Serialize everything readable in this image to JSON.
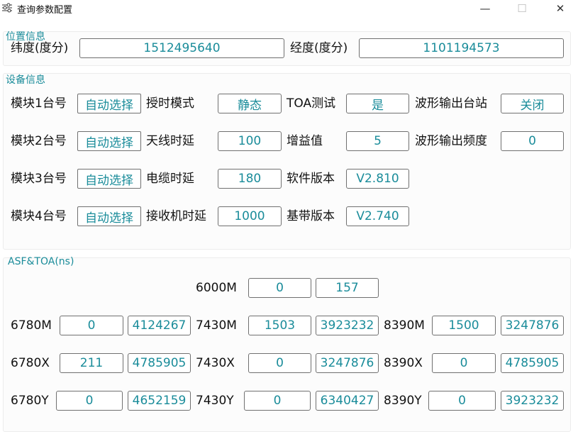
{
  "window": {
    "title": "查询参数配置",
    "icon": "sliders-icon",
    "controls": {
      "minimize": "—",
      "maximize": "☐",
      "close": "✕"
    }
  },
  "position_group": {
    "title": "位置信息",
    "latitude_label": "纬度(度分)",
    "latitude_value": "1512495640",
    "longitude_label": "经度(度分)",
    "longitude_value": "1101194573"
  },
  "device_group": {
    "title": "设备信息",
    "modules": [
      {
        "label": "模块1台号",
        "value": "自动选择"
      },
      {
        "label": "模块2台号",
        "value": "自动选择"
      },
      {
        "label": "模块3台号",
        "value": "自动选择"
      },
      {
        "label": "模块4台号",
        "value": "自动选择"
      }
    ],
    "timing_mode_label": "授时模式",
    "timing_mode_value": "静态",
    "antenna_delay_label": "天线时延",
    "antenna_delay_value": "100",
    "cable_delay_label": "电缆时延",
    "cable_delay_value": "180",
    "receiver_delay_label": "接收机时延",
    "receiver_delay_value": "1000",
    "toa_test_label": "TOA测试",
    "toa_test_value": "是",
    "gain_label": "增益值",
    "gain_value": "5",
    "software_version_label": "软件版本",
    "software_version_value": "V2.810",
    "baseband_version_label": "基带版本",
    "baseband_version_value": "V2.740",
    "waveform_station_label": "波形输出台站",
    "waveform_station_value": "关闭",
    "waveform_freq_label": "波形输出频度",
    "waveform_freq_value": "0"
  },
  "asf_group": {
    "title": "ASF&TOA(ns)",
    "row6000": {
      "label": "6000M",
      "asf": "0",
      "toa": "157"
    },
    "c6780": [
      {
        "label": "6780M",
        "asf": "0",
        "toa": "4124267"
      },
      {
        "label": "6780X",
        "asf": "211",
        "toa": "4785905"
      },
      {
        "label": "6780Y",
        "asf": "0",
        "toa": "4652159"
      }
    ],
    "c7430": [
      {
        "label": "7430M",
        "asf": "1503",
        "toa": "3923232"
      },
      {
        "label": "7430X",
        "asf": "0",
        "toa": "3247876"
      },
      {
        "label": "7430Y",
        "asf": "0",
        "toa": "6340427"
      }
    ],
    "c8390": [
      {
        "label": "8390M",
        "asf": "1500",
        "toa": "3247876"
      },
      {
        "label": "8390X",
        "asf": "0",
        "toa": "4785905"
      },
      {
        "label": "8390Y",
        "asf": "0",
        "toa": "3923232"
      }
    ]
  }
}
